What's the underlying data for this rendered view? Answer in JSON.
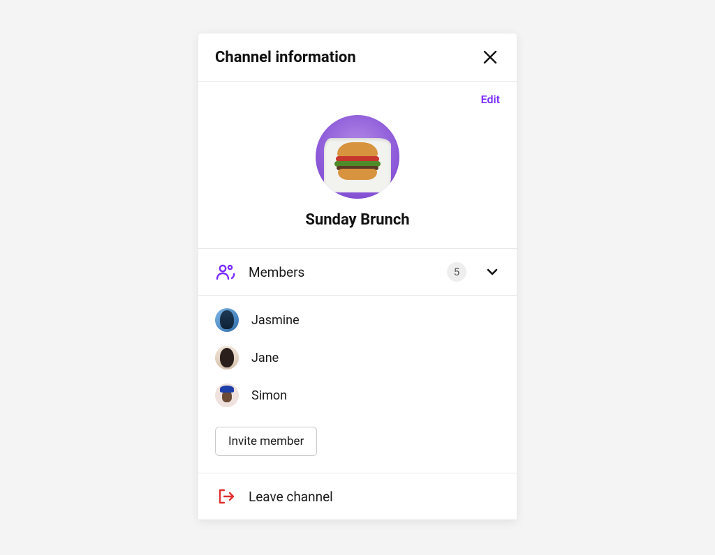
{
  "header": {
    "title": "Channel information"
  },
  "channel": {
    "edit_label": "Edit",
    "name": "Sunday Brunch"
  },
  "members_section": {
    "label": "Members",
    "count": "5"
  },
  "members": [
    {
      "name": "Jasmine"
    },
    {
      "name": "Jane"
    },
    {
      "name": "Simon"
    }
  ],
  "invite": {
    "button_label": "Invite member"
  },
  "leave": {
    "label": "Leave channel"
  },
  "colors": {
    "accent": "#7a2bff",
    "danger": "#e22f2f"
  }
}
